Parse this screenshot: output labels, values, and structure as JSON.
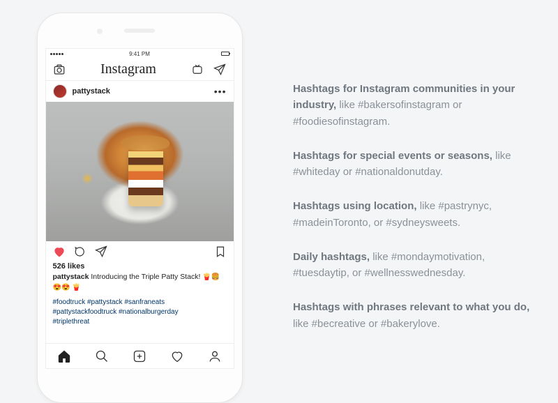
{
  "status": {
    "time": "9:41 PM"
  },
  "header": {
    "logo": "Instagram"
  },
  "post": {
    "username": "pattystack",
    "likes_label": "526 likes",
    "caption_user": "pattystack",
    "caption_text": "Introducing the Triple Patty Stack!",
    "caption_emojis": "🍟🍔 😍😍 🍟",
    "hashtags_line1": "#foodtruck #pattystack #sanfraneats",
    "hashtags_line2": "#pattystackfoodtruck #nationalburgerday",
    "hashtags_line3": "#triplethreat"
  },
  "tips": [
    {
      "bold": "Hashtags for Instagram communities in your industry,",
      "rest": " like #bakersofinstagram or #foodiesofinstagram."
    },
    {
      "bold": "Hashtags for special events or seasons,",
      "rest": " like #whiteday or #nationaldonutday."
    },
    {
      "bold": "Hashtags using location,",
      "rest": " like #pastrynyc, #madeinToronto, or #sydneysweets."
    },
    {
      "bold": "Daily hashtags,",
      "rest": " like #mondaymotivation, #tuesdaytip, or #wellnesswednesday."
    },
    {
      "bold": "Hashtags with phrases relevant to what you do,",
      "rest": " like #becreative or #bakerylove."
    }
  ]
}
